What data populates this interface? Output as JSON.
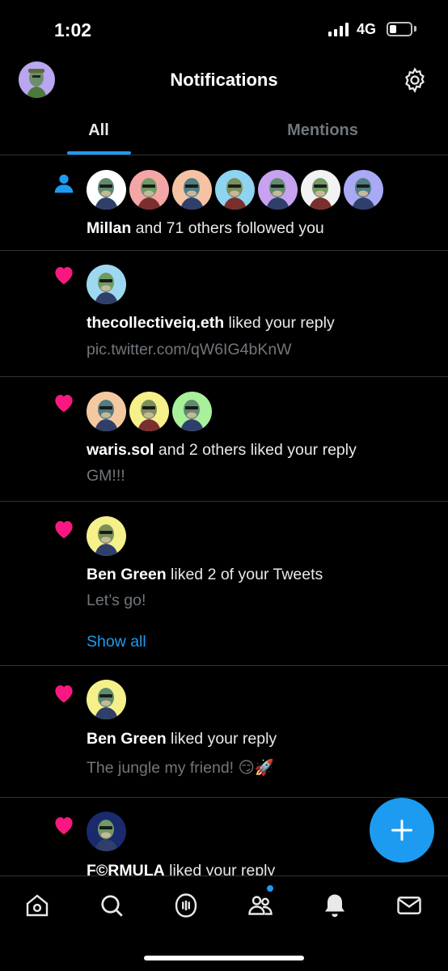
{
  "status": {
    "time": "1:02",
    "network": "4G",
    "battery_level": 0.35
  },
  "header": {
    "title": "Notifications",
    "avatar_icon": "ape-avatar",
    "settings_icon": "gear-icon"
  },
  "tabs": [
    {
      "label": "All",
      "active": true
    },
    {
      "label": "Mentions",
      "active": false
    }
  ],
  "notifications": [
    {
      "type": "follow",
      "icon": "person-icon",
      "avatar_colors": [
        "#ffffff",
        "#f4a6a6",
        "#f5c3a3",
        "#8ed3f0",
        "#c8a2f0",
        "#f2f2f2",
        "#a9a9f5"
      ],
      "actor": "Millan",
      "action": " and 71 others followed you"
    },
    {
      "type": "like",
      "icon": "heart-icon",
      "avatar_colors": [
        "#9ed8f0"
      ],
      "actor": "thecollectiveiq.eth",
      "action": " liked your reply",
      "sub": " pic.twitter.com/qW6IG4bKnW"
    },
    {
      "type": "like",
      "icon": "heart-icon",
      "avatar_colors": [
        "#f5c9a0",
        "#f5f08a",
        "#a8f09a"
      ],
      "actor": "waris.sol",
      "action": " and 2 others liked your reply",
      "sub": "GM!!!"
    },
    {
      "type": "like",
      "icon": "heart-icon",
      "avatar_colors": [
        "#f5f08a"
      ],
      "actor": "Ben Green",
      "action": " liked 2 of your Tweets",
      "sub": "Let’s go!",
      "link": "Show all"
    },
    {
      "type": "like",
      "icon": "heart-icon",
      "avatar_colors": [
        "#f5f08a"
      ],
      "actor": "Ben Green",
      "action": " liked your reply",
      "sub": "The jungle my friend! 😏🚀"
    },
    {
      "type": "like",
      "icon": "heart-icon",
      "avatar_colors": [
        "#1a2a6c"
      ],
      "actor": "F©RMULA",
      "action": " liked your reply"
    }
  ],
  "fab": {
    "icon": "plus-icon"
  },
  "bottom_nav": [
    {
      "name": "home-icon"
    },
    {
      "name": "search-icon"
    },
    {
      "name": "spaces-icon"
    },
    {
      "name": "communities-icon"
    },
    {
      "name": "bell-icon"
    },
    {
      "name": "mail-icon"
    }
  ],
  "colors": {
    "accent": "#1d9bf0",
    "like": "#f91880",
    "background": "#000000",
    "secondary_text": "#71767b"
  }
}
